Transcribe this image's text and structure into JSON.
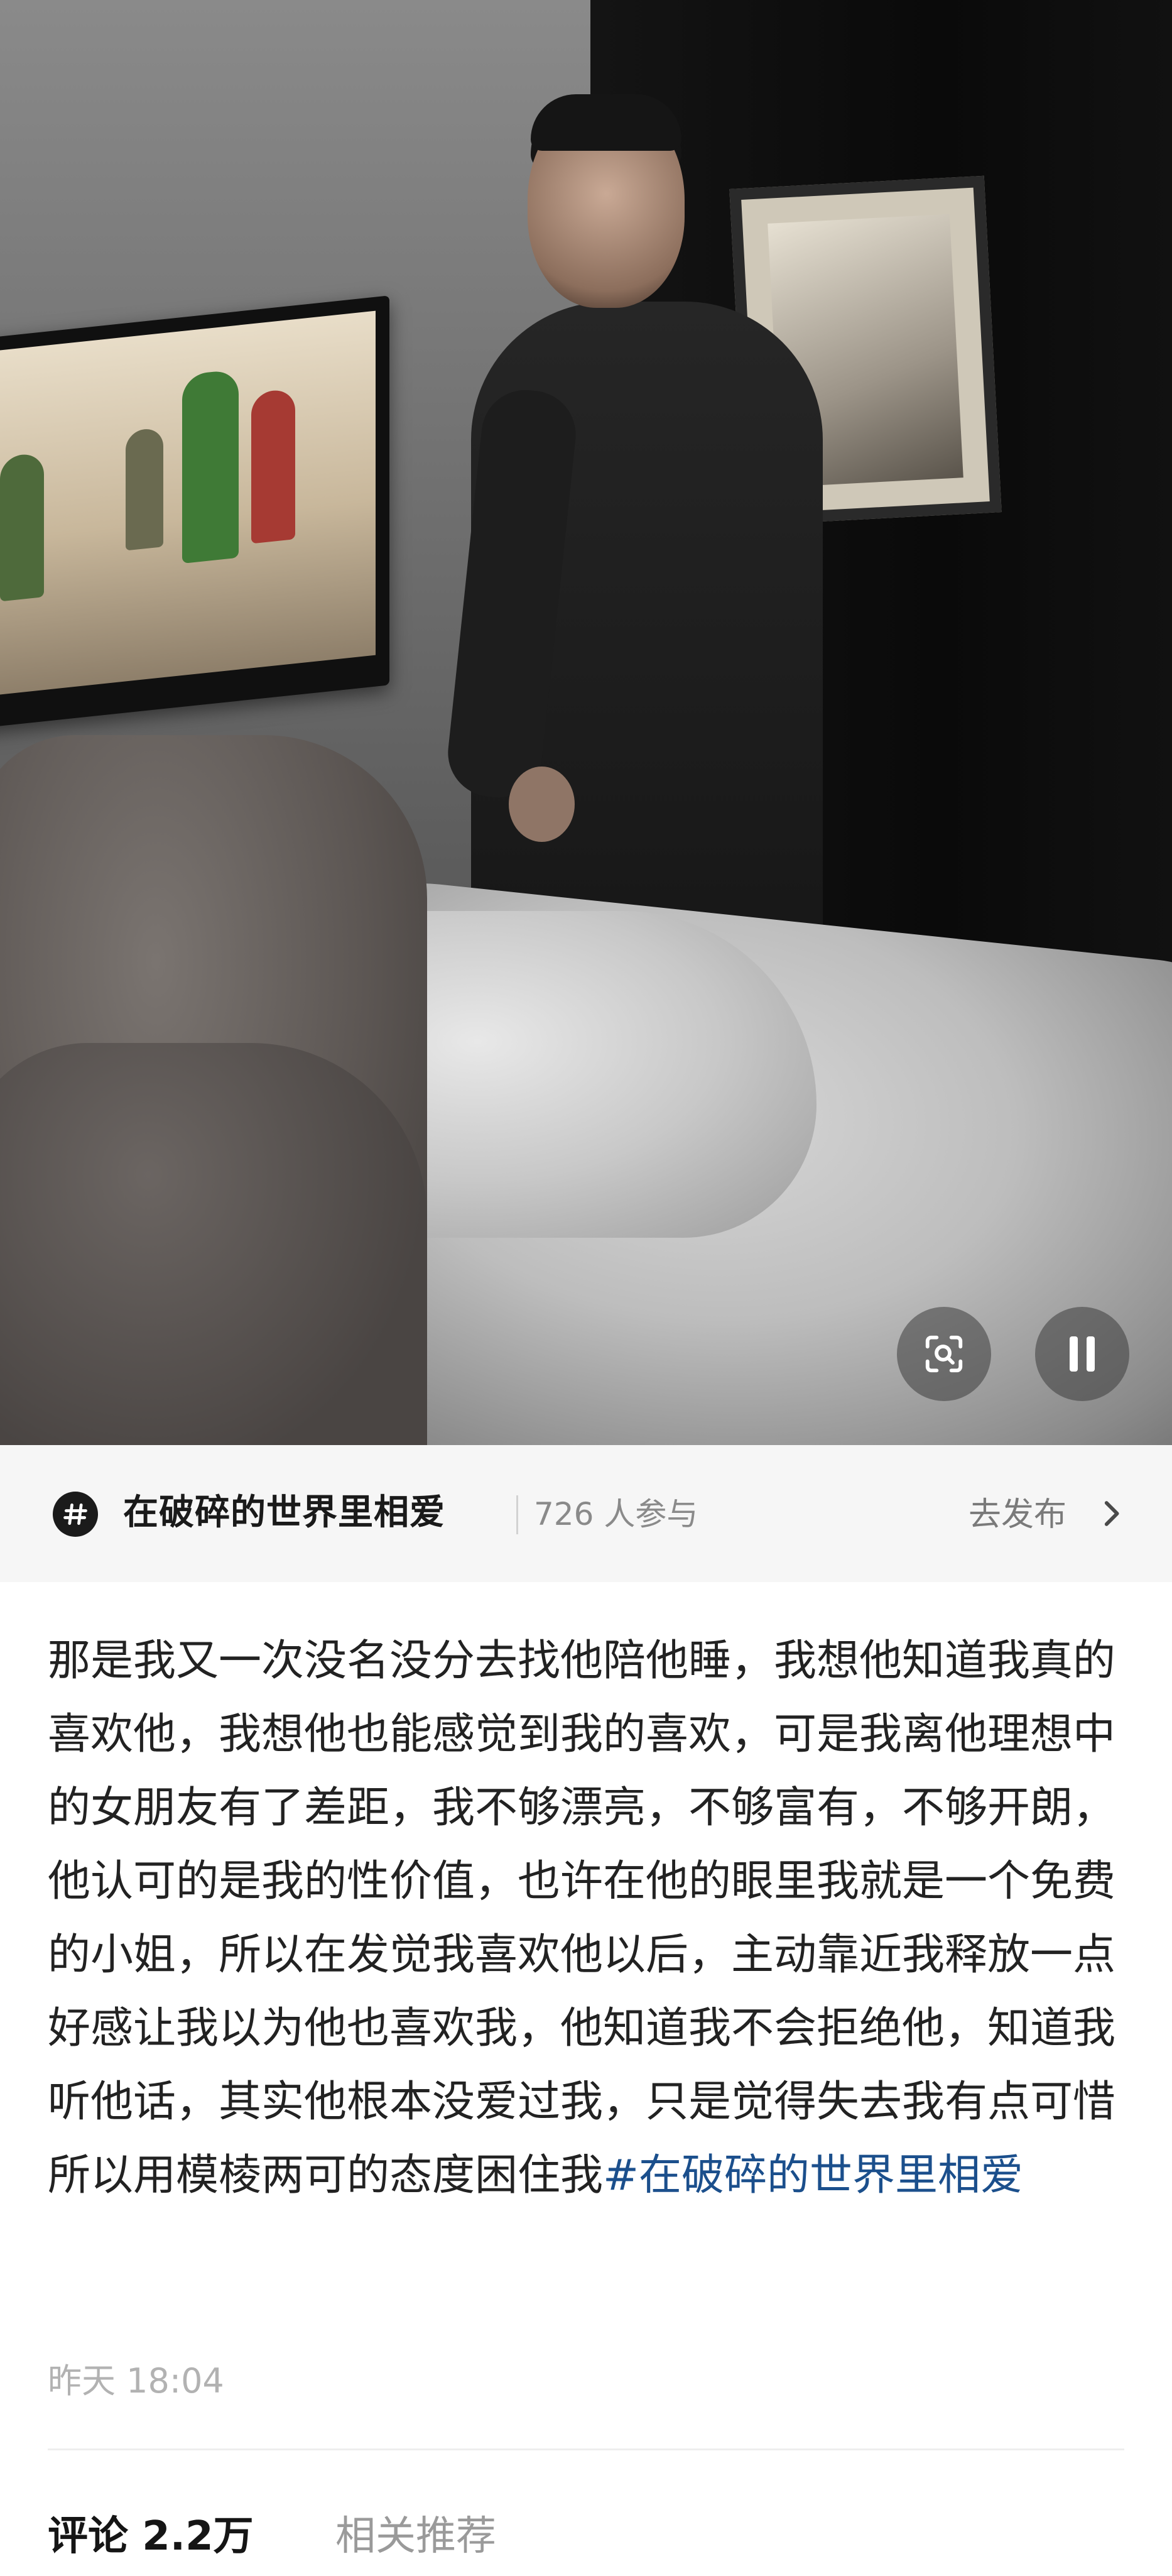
{
  "video": {
    "tv_caption": "",
    "controls": {
      "scan_icon": "scan-image-icon",
      "pause_icon": "pause-icon"
    }
  },
  "topic": {
    "icon": "hashtag-icon",
    "title": "在破碎的世界里相爱",
    "participants": "726 人参与",
    "post_label": "去发布",
    "chevron": "chevron-right-icon"
  },
  "post": {
    "text": "那是我又一次没名没分去找他陪他睡，我想他知道我真的喜欢他，我想他也能感觉到我的喜欢，可是我离他理想中的女朋友有了差距，我不够漂亮，不够富有，不够开朗，他认可的是我的性价值，也许在他的眼里我就是一个免费的小姐，所以在发觉我喜欢他以后，主动靠近我释放一点好感让我以为他也喜欢我，他知道我不会拒绝他，知道我听他话，其实他根本没爱过我，只是觉得失去我有点可惜 所以用模棱两可的态度困住我",
    "hashtag": "#在破碎的世界里相爱",
    "time": "昨天 18:04"
  },
  "tabs": {
    "comments": "评论 2.2万",
    "related": "相关推荐"
  },
  "colors": {
    "hashtag": "#1b4f8c",
    "topic_bar_bg": "#f6f6f6",
    "muted_text": "#8a8a8a"
  }
}
